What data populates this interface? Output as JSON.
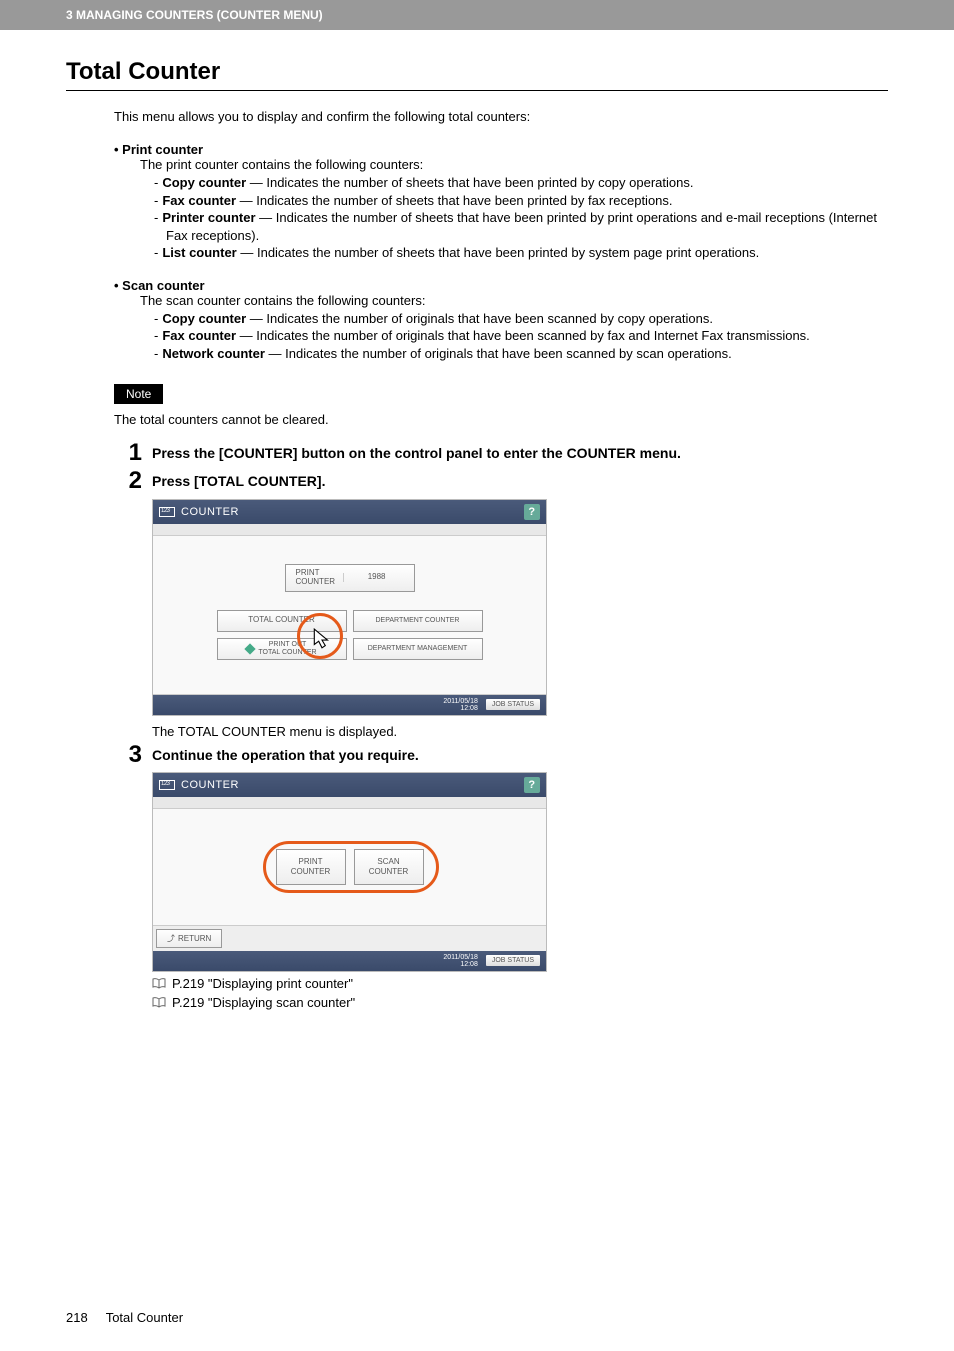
{
  "header": {
    "breadcrumb": "3 MANAGING COUNTERS (COUNTER MENU)"
  },
  "title": "Total Counter",
  "intro": "This menu allows you to display and confirm the following total counters:",
  "printCounter": {
    "name": "Print counter",
    "desc": "The print counter contains the following counters:",
    "items": [
      {
        "label": "Copy counter",
        "desc": " — Indicates the number of sheets that have been printed by copy operations."
      },
      {
        "label": "Fax counter",
        "desc": " — Indicates the number of sheets that have been printed by fax receptions."
      },
      {
        "label": "Printer counter",
        "desc": " — Indicates the number of sheets that have been printed by print operations and e-mail receptions (Internet Fax receptions)."
      },
      {
        "label": "List counter",
        "desc": " — Indicates the number of sheets that have been printed by system page print operations."
      }
    ]
  },
  "scanCounter": {
    "name": "Scan counter",
    "desc": "The scan counter contains the following counters:",
    "items": [
      {
        "label": "Copy counter",
        "desc": " — Indicates the number of originals that have been scanned by copy operations."
      },
      {
        "label": "Fax counter",
        "desc": " — Indicates the number of originals that have been scanned by fax and Internet Fax transmissions."
      },
      {
        "label": "Network counter",
        "desc": " — Indicates the number of originals that have been scanned by scan operations."
      }
    ]
  },
  "note": {
    "label": "Note",
    "text": "The total counters cannot be cleared."
  },
  "steps": {
    "s1": {
      "num": "1",
      "title": "Press the [COUNTER] button on the control panel to enter the COUNTER menu."
    },
    "s2": {
      "num": "2",
      "title": "Press [TOTAL COUNTER].",
      "after": "The TOTAL COUNTER menu is displayed."
    },
    "s3": {
      "num": "3",
      "title": "Continue the operation that you require."
    }
  },
  "screen1": {
    "header": "COUNTER",
    "help": "?",
    "printCounterBtn": "PRINT COUNTER",
    "printCounterVal": "1988",
    "totalCounterBtn": "TOTAL COUNTER",
    "deptCounterBtn": "DEPARTMENT COUNTER",
    "printOutBtn": "PRINT OUT\nTOTAL COUNTER",
    "deptMgmtBtn": "DEPARTMENT MANAGEMENT",
    "date": "2011/05/18",
    "time": "12:08",
    "jobStatus": "JOB STATUS"
  },
  "screen2": {
    "header": "COUNTER",
    "help": "?",
    "printBtn": "PRINT\nCOUNTER",
    "scanBtn": "SCAN\nCOUNTER",
    "returnBtn": "RETURN",
    "date": "2011/05/18",
    "time": "12:08",
    "jobStatus": "JOB STATUS"
  },
  "refs": {
    "r1": "P.219 \"Displaying print counter\"",
    "r2": "P.219 \"Displaying scan counter\""
  },
  "footer": {
    "page": "218",
    "title": "Total Counter"
  }
}
